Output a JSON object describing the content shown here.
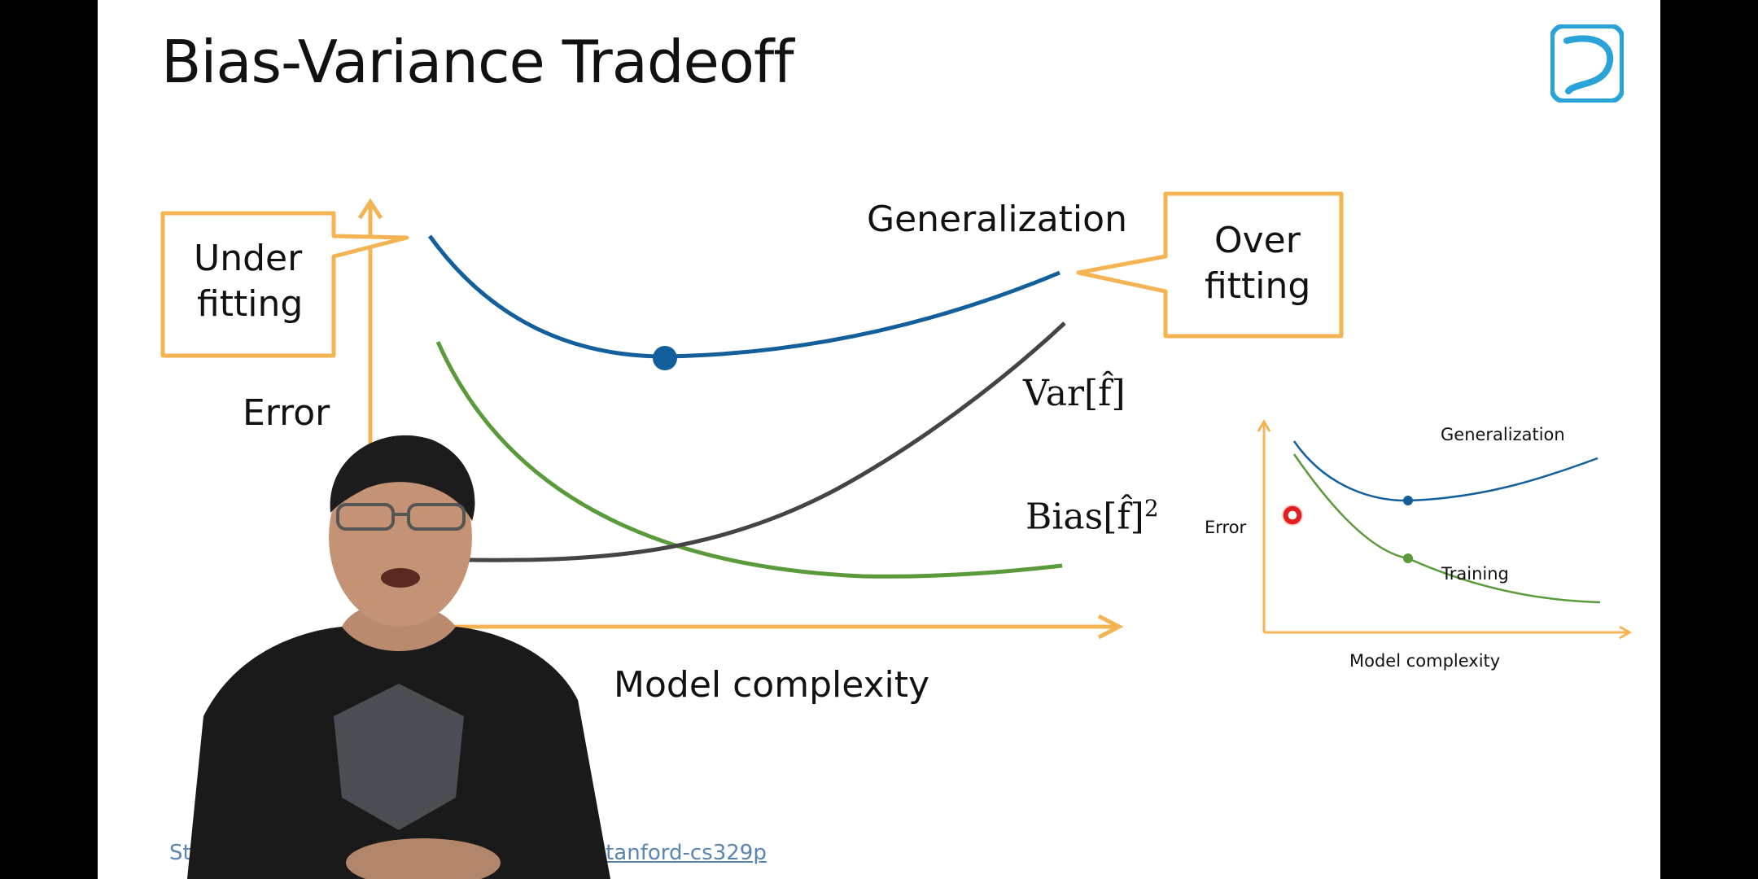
{
  "slide": {
    "title": "Bias-Variance Tradeoff",
    "callout_under": [
      "Under",
      "fitting"
    ],
    "callout_over": [
      "Over",
      "fitting"
    ],
    "y_axis_label": "Error",
    "x_axis_label": "Model complexity",
    "curve_labels": {
      "generalization": "Generalization",
      "variance": "Var[f̂]",
      "bias_base": "Bias[f̂]",
      "bias_sup": "2"
    },
    "footer_prefix": "Sta",
    "footer_suffix": "ai/stanford-cs329p"
  },
  "inset": {
    "generalization_label": "Generalization",
    "training_label": "Training",
    "y_label": "Error",
    "x_label": "Model complexity"
  },
  "colors": {
    "axis": "#f5b454",
    "generalization": "#135f9b",
    "bias": "#5a9a3a",
    "variance": "#444444",
    "cursor": "#e31e1e"
  },
  "icons": {
    "logo": "bilibili-logo",
    "cursor": "cursor-indicator"
  }
}
